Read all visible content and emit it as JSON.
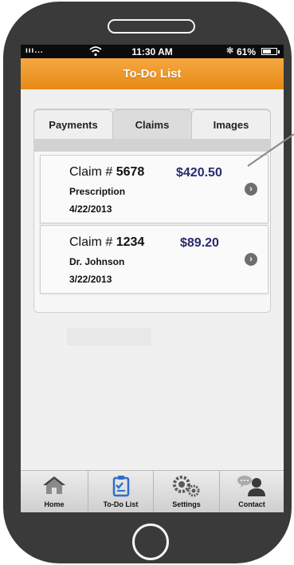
{
  "status_bar": {
    "signal": "ııı...",
    "time": "11:30 AM",
    "bluetooth": "✱",
    "battery_text": "61%",
    "battery_level": 0.61
  },
  "nav": {
    "title": "To-Do List"
  },
  "tabs": [
    {
      "label": "Payments",
      "active": false
    },
    {
      "label": "Claims",
      "active": true
    },
    {
      "label": "Images",
      "active": false
    }
  ],
  "claims": [
    {
      "label": "Claim #",
      "number": "5678",
      "amount": "$420.50",
      "subtitle": "Prescription",
      "date": "4/22/2013"
    },
    {
      "label": "Claim #",
      "number": "1234",
      "amount": "$89.20",
      "subtitle": "Dr. Johnson",
      "date": "3/22/2013"
    }
  ],
  "bottom_tabs": [
    {
      "label": "Home",
      "icon": "home-icon"
    },
    {
      "label": "To-Do List",
      "icon": "clipboard-check-icon"
    },
    {
      "label": "Settings",
      "icon": "gears-icon"
    },
    {
      "label": "Contact",
      "icon": "contact-icon"
    }
  ],
  "colors": {
    "nav_orange": "#ed941f",
    "amount_navy": "#2a2a6e",
    "todo_icon_blue": "#2f6fc8"
  }
}
